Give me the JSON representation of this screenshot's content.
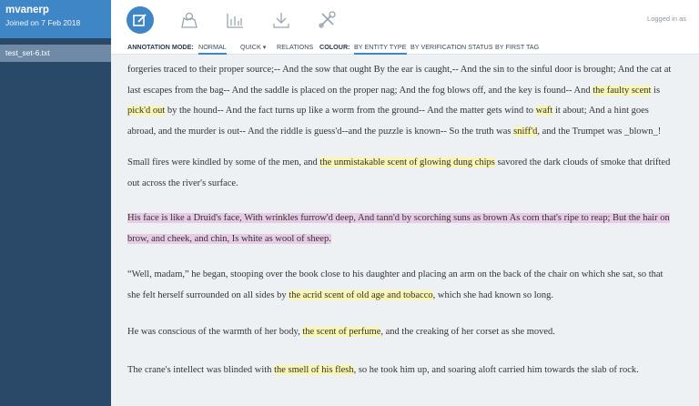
{
  "user": {
    "name": "mvanerp",
    "joined": "Joined on 7 Feb 2018"
  },
  "files": [
    {
      "name": "test_set-6.txt"
    }
  ],
  "header": {
    "logged_in": "Logged in as"
  },
  "modebar": {
    "annotation_mode_label": "ANNOTATION MODE:",
    "normal": "NORMAL",
    "quick": "QUICK",
    "relations": "RELATIONS",
    "colour_label": "COLOUR:",
    "by_entity_type": "BY ENTITY TYPE",
    "by_verification_status": "BY VERIFICATION STATUS",
    "by_first_tag": "BY FIRST TAG"
  },
  "colors": {
    "accent": "#3f86c7",
    "sidebar": "#2a4868",
    "highlight_yellow": "#f8f6b2",
    "highlight_purple": "#e8cbe4"
  },
  "paragraphs": [
    {
      "p1": "forgeries traced to their proper source;-- And the sow that ought By the ear is caught,-- And the sin to the sinful door is brought; And the cat at last escapes from the bag-- And the saddle is placed on the proper nag; And the fog blows off, and the key is found-- And ",
      "h1": "the faulty scent",
      "p2": " is ",
      "h2": "pick'd out",
      "p3": " by the hound-- And the fact turns up like a worm from the ground-- And the matter gets wind to ",
      "h3": "waft",
      "p4": " it about; And a hint goes abroad, and the murder is out-- And the riddle is guess'd--and the puzzle is known-- So the truth was ",
      "h4": "sniff'd",
      "p5": ", and the Trumpet was _blown_!"
    },
    {
      "p1": "Small fires were kindled by some of the men, and ",
      "h1": "the unmistakable scent of glowing dung chips",
      "p2": " savored the dark clouds of smoke that drifted out across the river's surface."
    },
    {
      "h1": "His face is like a Druid's face, With wrinkles furrow'd deep, And tann'd by scorching suns as brown As corn that's ripe to reap; But the hair on brow, and cheek, and chin, Is white as wool of sheep."
    },
    {
      "p1": "“Well, madam,” he began, stooping over the book close to his daughter and placing an arm on the back of the chair on which she sat, so that she felt herself surrounded on all sides by ",
      "h1": "the acrid scent of old age and tobacco",
      "p2": ", which she had known so long."
    },
    {
      "p1": "He was conscious of the warmth of her body, ",
      "h1": "the scent of perfume",
      "p2": ", and the creaking of her corset as she moved."
    },
    {
      "p1": "The crane's intellect was blinded with ",
      "h1": "the smell of his flesh",
      "p2": ", so he took him up, and soaring aloft carried him towards the slab of rock."
    }
  ]
}
